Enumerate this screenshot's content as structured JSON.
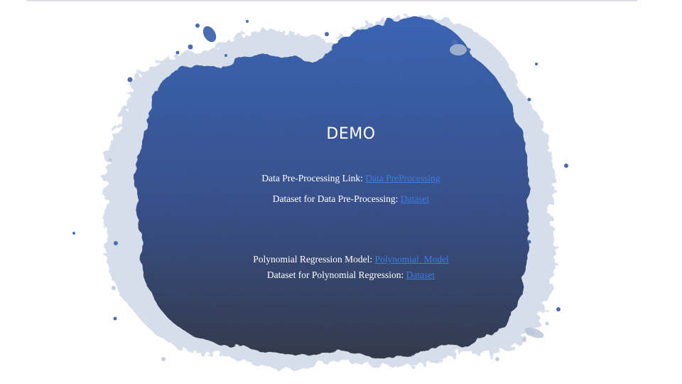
{
  "slide": {
    "title": "DEMO",
    "lines": [
      {
        "label": "Data Pre-Processing Link:",
        "link_text": "Data PreProcessing"
      },
      {
        "label": "Dataset for Data Pre-Processing:",
        "link_text": "Dataset"
      },
      {
        "label": "Polynomial Regression Model:",
        "link_text": "Polynomial_Model"
      },
      {
        "label": "Dataset for Polynomial Regression:",
        "link_text": "Dataset"
      }
    ]
  },
  "colors": {
    "splash_top": "#3a64b2",
    "splash_bottom": "#353a4c",
    "link": "#3b7de0",
    "text": "#ffffff",
    "background": "#ffffff"
  }
}
